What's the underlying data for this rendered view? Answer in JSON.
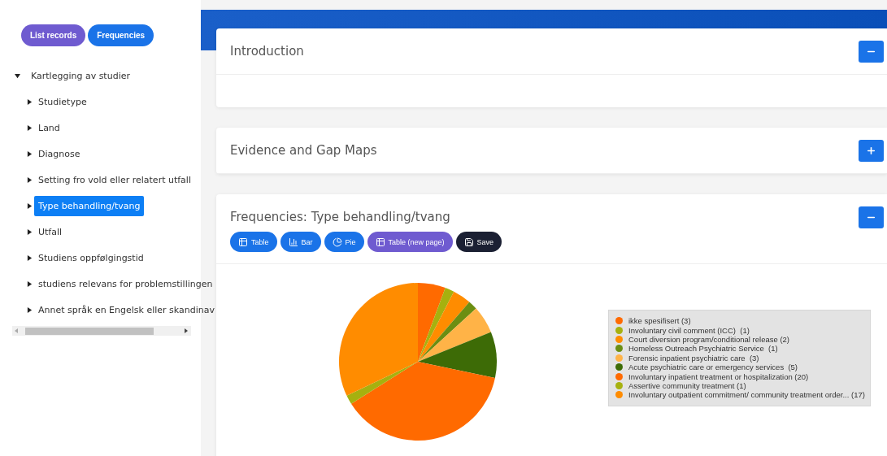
{
  "sidebar": {
    "nav_buttons": [
      {
        "label": "List records",
        "selected": false
      },
      {
        "label": "Frequencies",
        "selected": true
      }
    ],
    "tree": {
      "label": "Kartlegging av studier",
      "expanded": true,
      "selected": false,
      "children": [
        {
          "label": "Studietype",
          "expanded": false,
          "selected": false
        },
        {
          "label": "Land",
          "expanded": false,
          "selected": false
        },
        {
          "label": "Diagnose",
          "expanded": false,
          "selected": false
        },
        {
          "label": "Setting fro vold eller relatert utfall",
          "expanded": false,
          "selected": false
        },
        {
          "label": "Type behandling/tvang",
          "expanded": false,
          "selected": true
        },
        {
          "label": "Utfall",
          "expanded": false,
          "selected": false
        },
        {
          "label": "Studiens oppfølgingstid",
          "expanded": false,
          "selected": false
        },
        {
          "label": "studiens relevans for problemstillingen",
          "expanded": false,
          "selected": false
        },
        {
          "label": "Annet språk en Engelsk eller skandinav",
          "expanded": false,
          "selected": false
        }
      ]
    }
  },
  "panels": [
    {
      "title": "Introduction",
      "expanded": true
    },
    {
      "title": "Evidence and Gap Maps",
      "expanded": false
    },
    {
      "title": "Frequencies: Type behandling/tvang",
      "expanded": true,
      "buttons": [
        {
          "label": "Table",
          "kind": "table"
        },
        {
          "label": "Bar",
          "kind": "bar"
        },
        {
          "label": "Pie",
          "kind": "pie"
        },
        {
          "label": "Table (new page)",
          "kind": "newpage"
        },
        {
          "label": "Save",
          "kind": "save"
        }
      ],
      "legend": [
        {
          "color": "#ff6a00"
        },
        {
          "color": "#a6b10f"
        },
        {
          "color": "#ff8c00"
        },
        {
          "color": "#6b8e12"
        },
        {
          "color": "#ffb347"
        },
        {
          "color": "#3d6b06"
        },
        {
          "color": "#ff6a00"
        },
        {
          "color": "#a6b10f"
        },
        {
          "color": "#ff8c00"
        }
      ],
      "chart_data": {
        "type": "pie",
        "categories": [
          "ikke spesifisert (3)",
          "Involuntary civil comment (ICC)  (1)",
          "Court diversion program/conditional release (2)",
          "Homeless Outreach Psychiatric Service  (1)",
          "Forensic inpatient psychiatric care  (3)",
          "Acute psychiatric care or emergency services  (5)",
          "Involuntary inpatient treatment or hospitalization (20)",
          "Assertive community treatment (1)",
          "Involuntary outpatient commitment/ community treatment order... (17)"
        ],
        "values": [
          3,
          1,
          2,
          1,
          3,
          5,
          20,
          1,
          17
        ]
      }
    }
  ]
}
